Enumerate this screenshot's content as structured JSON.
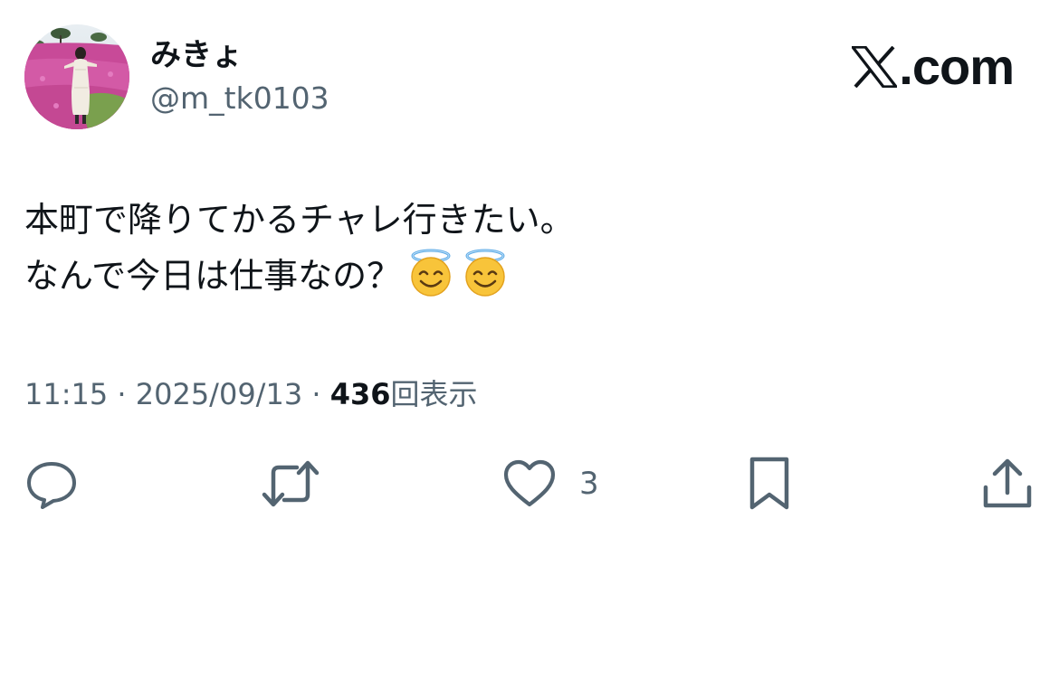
{
  "user": {
    "display_name": "みきょ",
    "handle": "@m_tk0103",
    "avatar_icon": "profile-photo"
  },
  "brand": {
    "label": ".com",
    "icon": "x-logo-icon"
  },
  "tweet": {
    "line1": "本町で降りてかるチャレ行きたい。",
    "line2": "なんで今日は仕事なの？",
    "emojis": [
      "smiling-face-with-halo-icon",
      "smiling-face-with-halo-icon"
    ]
  },
  "meta": {
    "time": "11:15",
    "separator": " · ",
    "date": "2025/09/13",
    "views_count": "436",
    "views_label": "回表示"
  },
  "actions": {
    "reply_icon": "reply-icon",
    "retweet_icon": "retweet-icon",
    "like_icon": "heart-icon",
    "like_count": "3",
    "bookmark_icon": "bookmark-icon",
    "share_icon": "share-icon"
  },
  "colors": {
    "text_primary": "#0f1419",
    "text_secondary": "#536471",
    "background": "#ffffff"
  }
}
